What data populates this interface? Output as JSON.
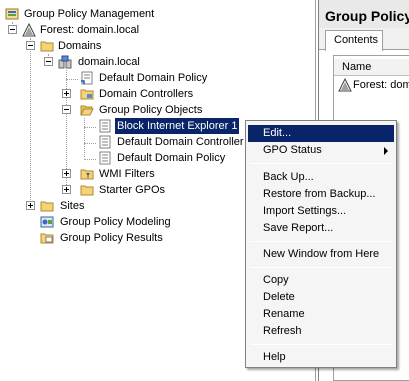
{
  "tree": {
    "root": "Group Policy Management",
    "forest": "Forest: domain.local",
    "domains": "Domains",
    "domain": "domain.local",
    "default_domain_policy_link": "Default Domain Policy",
    "domain_controllers": "Domain Controllers",
    "gpo_folder": "Group Policy Objects",
    "gpo_items": [
      "Block Internet Explorer 1",
      "Default Domain Controller",
      "Default Domain Policy"
    ],
    "wmi_filters": "WMI Filters",
    "starter_gpos": "Starter GPOs",
    "sites": "Sites",
    "modeling": "Group Policy Modeling",
    "results": "Group Policy Results"
  },
  "right_pane": {
    "title": "Group Policy",
    "tab": "Contents",
    "column": "Name",
    "row": "Forest: dom"
  },
  "context_menu": {
    "edit": "Edit...",
    "gpo_status": "GPO Status",
    "back_up": "Back Up...",
    "restore": "Restore from Backup...",
    "import": "Import Settings...",
    "save_report": "Save Report...",
    "new_window": "New Window from Here",
    "copy": "Copy",
    "delete": "Delete",
    "rename": "Rename",
    "refresh": "Refresh",
    "help": "Help"
  }
}
